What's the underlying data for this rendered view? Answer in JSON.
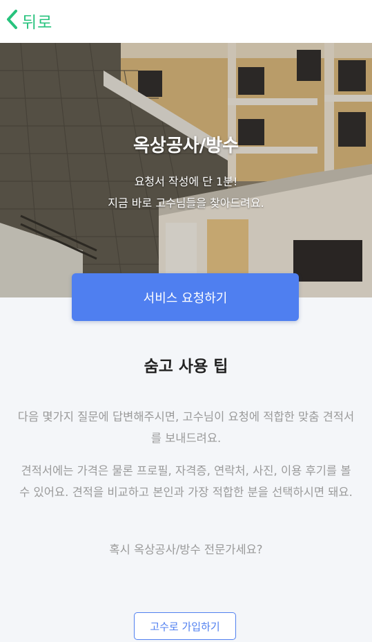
{
  "nav": {
    "back_label": "뒤로",
    "back_icon": "chevron-left-icon",
    "accent_color": "#27c37d"
  },
  "hero": {
    "title": "옥상공사/방수",
    "subtitle_line1": "요청서 작성에 단 1분!",
    "subtitle_line2": "지금 바로 고수님들을 찾아드려요."
  },
  "cta": {
    "label": "서비스 요청하기",
    "color": "#4f7ff0"
  },
  "tips": {
    "title": "숨고 사용 팁",
    "paragraph1": "다음 몇가지 질문에 답변해주시면, 고수님이 요청에 적합한 맞춤 견적서를 보내드려요.",
    "paragraph2": "견적서에는 가격은 물론 프로필, 자격증, 연락처, 사진, 이용 후기를 볼 수 있어요. 견적을 비교하고 본인과 가장 적합한 분을 선택하시면 돼요.",
    "question": "혹시 옥상공사/방수 전문가세요?"
  },
  "signup": {
    "label": "고수로 가입하기"
  }
}
